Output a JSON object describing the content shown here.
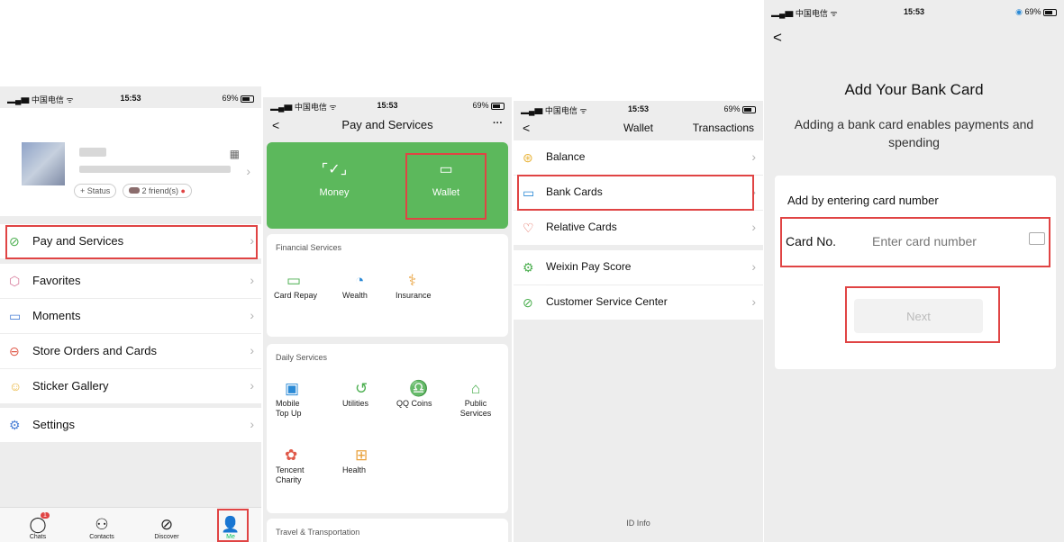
{
  "screen1": {
    "status": {
      "carrier": "中国电信",
      "time": "15:53",
      "battery": "69%"
    },
    "profile": {
      "status_btn": "+ Status",
      "friends": "2 friend(s)"
    },
    "menu": [
      {
        "icon": "pay-services-icon",
        "label": "Pay and Services"
      },
      {
        "icon": "favorites-icon",
        "label": "Favorites"
      },
      {
        "icon": "moments-icon",
        "label": "Moments"
      },
      {
        "icon": "store-orders-icon",
        "label": "Store Orders and Cards"
      },
      {
        "icon": "sticker-icon",
        "label": "Sticker Gallery"
      },
      {
        "icon": "settings-icon",
        "label": "Settings"
      }
    ],
    "tabs": [
      {
        "label": "Chats",
        "badge": "1"
      },
      {
        "label": "Contacts"
      },
      {
        "label": "Discover"
      },
      {
        "label": "Me"
      }
    ]
  },
  "screen2": {
    "status": {
      "carrier": "中国电信",
      "time": "15:53",
      "battery": "69%"
    },
    "nav": {
      "back": "<",
      "title": "Pay and Services",
      "more": "···"
    },
    "green": {
      "money": "Money",
      "wallet": "Wallet"
    },
    "financial": {
      "title": "Financial Services",
      "items": [
        "Card Repay",
        "Wealth",
        "Insurance"
      ]
    },
    "daily": {
      "title": "Daily Services",
      "items": [
        "Mobile Top Up",
        "Utilities",
        "QQ Coins",
        "Public Services",
        "Tencent Charity",
        "Health"
      ]
    },
    "travel": {
      "title": "Travel & Transportation"
    }
  },
  "screen3": {
    "status": {
      "carrier": "中国电信",
      "time": "15:53",
      "battery": "69%"
    },
    "nav": {
      "back": "<",
      "title": "Wallet",
      "right": "Transactions"
    },
    "rows": [
      "Balance",
      "Bank Cards",
      "Relative Cards",
      "Weixin Pay Score",
      "Customer Service Center"
    ],
    "footer": "ID Info"
  },
  "screen4": {
    "status": {
      "carrier": "中国电信",
      "time": "15:53",
      "battery": "69%"
    },
    "back": "<",
    "title": "Add Your Bank Card",
    "subtitle": "Adding a bank card enables payments and spending",
    "section_title": "Add by entering card number",
    "card_label": "Card No.",
    "card_placeholder": "Enter card number",
    "card_value": "",
    "next": "Next"
  },
  "colors": {
    "green": "#5cb85c",
    "red": "#e04444",
    "bg_gray": "#ededed"
  }
}
